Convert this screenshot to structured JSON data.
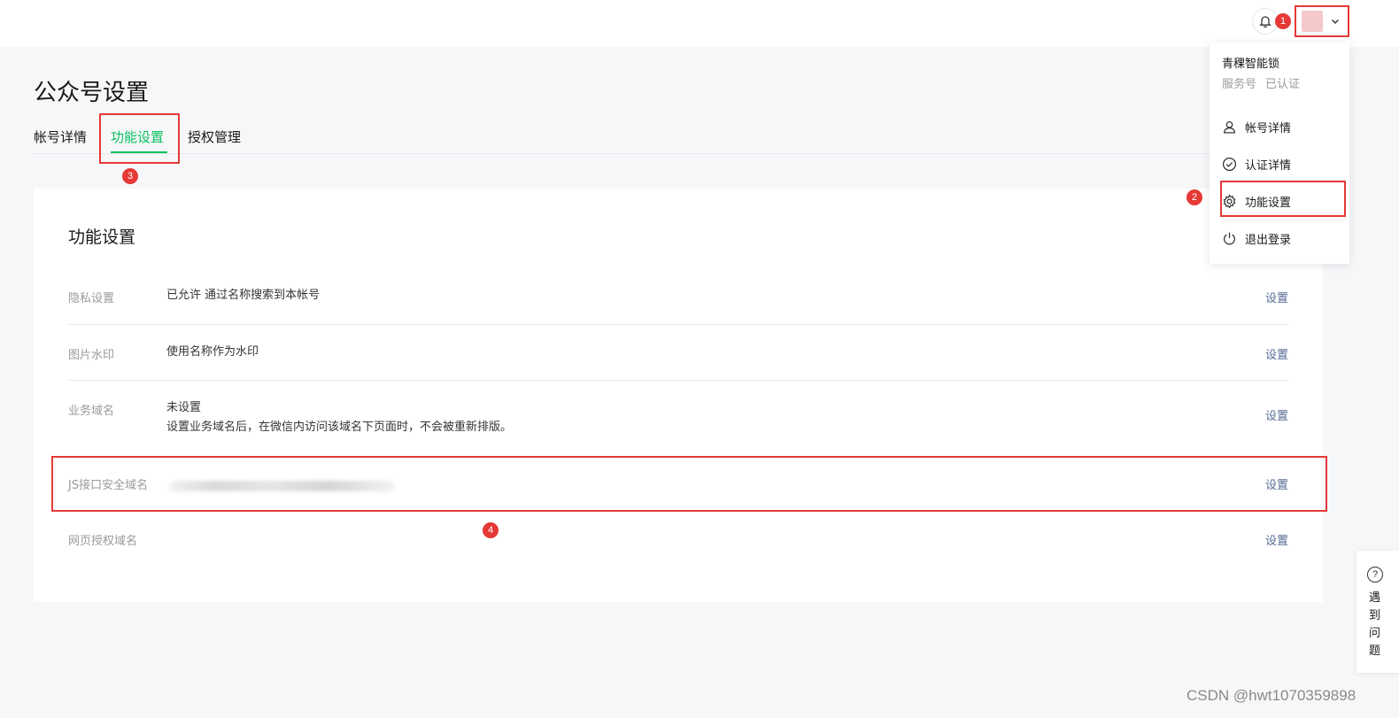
{
  "header": {
    "bell_icon": "bell-icon",
    "avatar_chevron_icon": "chevron-down-icon"
  },
  "markers": [
    "1",
    "2",
    "3",
    "4"
  ],
  "page": {
    "title": "公众号设置"
  },
  "tabs": [
    {
      "label": "帐号详情"
    },
    {
      "label": "功能设置",
      "active": true
    },
    {
      "label": "授权管理"
    }
  ],
  "card": {
    "title": "功能设置",
    "rows": [
      {
        "label": "隐私设置",
        "value": "已允许 通过名称搜索到本帐号",
        "action": "设置"
      },
      {
        "label": "图片水印",
        "value": "使用名称作为水印",
        "action": "设置"
      },
      {
        "label": "业务域名",
        "value": "未设置",
        "value2": "设置业务域名后，在微信内访问该域名下页面时，不会被重新排版。",
        "action": "设置"
      },
      {
        "label": "JS接口安全域名",
        "value": "",
        "action": "设置"
      },
      {
        "label": "网页授权域名",
        "value": "",
        "action": "设置"
      }
    ]
  },
  "dropdown": {
    "account_name": "青稞智能锁",
    "account_type": "服务号",
    "account_status": "已认证",
    "items": [
      {
        "label": "帐号详情",
        "icon": "user-icon"
      },
      {
        "label": "认证详情",
        "icon": "check-circle-icon"
      },
      {
        "label": "功能设置",
        "icon": "gear-icon"
      },
      {
        "label": "退出登录",
        "icon": "power-icon"
      }
    ]
  },
  "help": {
    "label": "遇到问题"
  },
  "watermark": "CSDN @hwt1070359898",
  "colors": {
    "accent": "#07c160",
    "link": "#576b95",
    "annotation": "#e53935"
  }
}
